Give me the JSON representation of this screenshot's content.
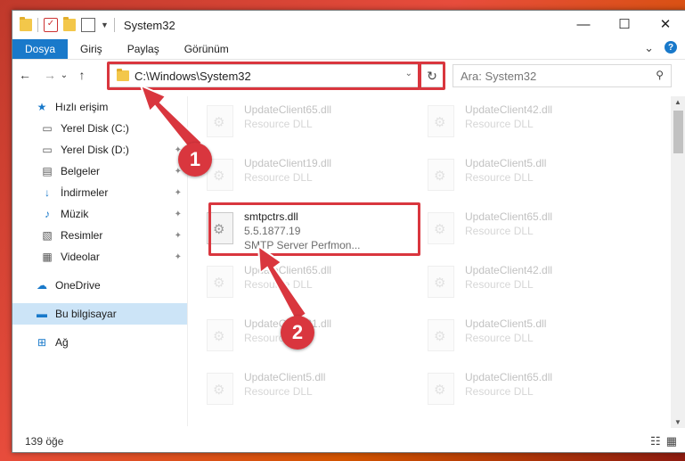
{
  "window": {
    "title": "System32",
    "controls": {
      "minimize": "—",
      "maximize": "☐",
      "close": "✕"
    }
  },
  "ribbon": {
    "tabs": [
      "Dosya",
      "Giriş",
      "Paylaş",
      "Görünüm"
    ],
    "expand_glyph": "⌄",
    "help_glyph": "?"
  },
  "nav": {
    "back": "←",
    "forward": "→",
    "recent": "⌄",
    "up": "↑",
    "address": "C:\\Windows\\System32",
    "address_dropdown": "⌄",
    "refresh": "↻",
    "search_placeholder": "Ara: System32",
    "search_icon": "⚲"
  },
  "sidebar": {
    "items": [
      {
        "label": "Hızlı erişim",
        "icon": "star-icon",
        "glyph": "★"
      },
      {
        "label": "Yerel Disk (C:)",
        "icon": "drive-icon",
        "glyph": "▭"
      },
      {
        "label": "Yerel Disk (D:)",
        "icon": "drive-icon",
        "glyph": "▭"
      },
      {
        "label": "Belgeler",
        "icon": "documents-icon",
        "glyph": "▤"
      },
      {
        "label": "İndirmeler",
        "icon": "downloads-icon",
        "glyph": "↓"
      },
      {
        "label": "Müzik",
        "icon": "music-icon",
        "glyph": "♪"
      },
      {
        "label": "Resimler",
        "icon": "pictures-icon",
        "glyph": "▧"
      },
      {
        "label": "Videolar",
        "icon": "videos-icon",
        "glyph": "▦"
      },
      {
        "label": "OneDrive",
        "icon": "cloud-icon",
        "glyph": "☁"
      },
      {
        "label": "Bu bilgisayar",
        "icon": "computer-icon",
        "glyph": "▬"
      },
      {
        "label": "Ağ",
        "icon": "network-icon",
        "glyph": "⊞"
      }
    ],
    "pin_glyph": "✦"
  },
  "files": [
    {
      "name": "UpdateClient65.dll",
      "desc": "Resource DLL"
    },
    {
      "name": "UpdateClient42.dll",
      "desc": "Resource DLL"
    },
    {
      "name": "UpdateClient19.dll",
      "desc": "Resource DLL"
    },
    {
      "name": "UpdateClient5.dll",
      "desc": "Resource DLL"
    },
    {
      "name": "smtpctrs.dll",
      "version": "5.5.1877.19",
      "desc": "SMTP Server Perfmon..."
    },
    {
      "name": "UpdateClient65.dll",
      "desc": "Resource DLL"
    },
    {
      "name": "UpdateClient65.dll",
      "desc": "Resource DLL"
    },
    {
      "name": "UpdateClient42.dll",
      "desc": "Resource DLL"
    },
    {
      "name": "UpdateClient21.dll",
      "desc": "Resource DLL"
    },
    {
      "name": "UpdateClient5.dll",
      "desc": "Resource DLL"
    },
    {
      "name": "UpdateClient5.dll",
      "desc": "Resource DLL"
    },
    {
      "name": "UpdateClient65.dll",
      "desc": "Resource DLL"
    }
  ],
  "status": {
    "count": "139 öğe",
    "details_view": "☷",
    "tiles_view": "▦"
  },
  "annotations": {
    "step1": "1",
    "step2": "2",
    "color": "#d9363e"
  }
}
